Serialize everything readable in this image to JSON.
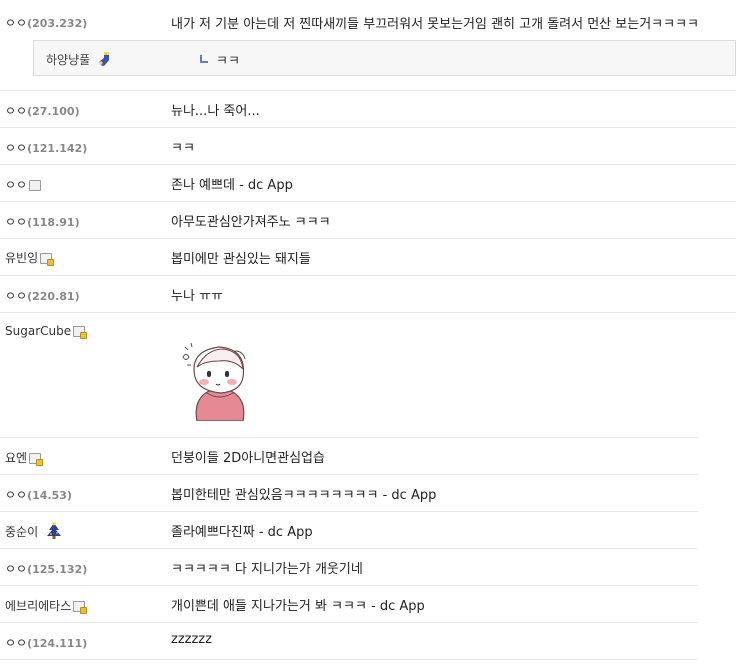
{
  "comments": [
    {
      "nick": "ㅇㅇ",
      "ip": "(203.232)",
      "text": "내가 저 기분 아는데 저 찐따새끼들 부끄러워서 못보는거임 괜히 고개 돌려서 먼산 보는거ㅋㅋㅋㅋ"
    },
    {
      "nick": "ㅇㅇ",
      "ip": "(27.100)",
      "text": "뉴나...나 죽어..."
    },
    {
      "nick": "ㅇㅇ",
      "ip": "(121.142)",
      "text": "ㅋㅋ"
    },
    {
      "nick": "ㅇㅇ",
      "ip": "",
      "text": "존나 예쁘데 - dc App"
    },
    {
      "nick": "ㅇㅇ",
      "ip": "(118.91)",
      "text": "아무도관심안가져주노 ㅋㅋㅋ"
    },
    {
      "nick": "유빈잉",
      "ip": "",
      "text": "봅미에만 관심있는 돼지들"
    },
    {
      "nick": "ㅇㅇ",
      "ip": "(220.81)",
      "text": "누나 ㅠㅠ"
    },
    {
      "nick": "SugarCube",
      "ip": "",
      "text": ""
    },
    {
      "nick": "요엔",
      "ip": "",
      "text": "던붕이들 2D아니면관심업습"
    },
    {
      "nick": "ㅇㅇ",
      "ip": "(14.53)",
      "text": "봅미한테만 관심있음ㅋㅋㅋㅋㅋㅋㅋㅋ - dc App"
    },
    {
      "nick": "중순이",
      "ip": "",
      "text": "졸라예쁘다진짜 - dc App"
    },
    {
      "nick": "ㅇㅇ",
      "ip": "(125.132)",
      "text": "ㅋㅋㅋㅋㅋ 다 지니가는가 개웃기네"
    },
    {
      "nick": "에브리에타스",
      "ip": "",
      "text": "개이쁜데 애들 지나가는거 봐 ㅋㅋㅋ - dc App"
    },
    {
      "nick": "ㅇㅇ",
      "ip": "(124.111)",
      "text": "zzzzzz"
    }
  ],
  "reply": {
    "nick": "하양냥풀",
    "text": "ㅋㅋ"
  },
  "icons": {
    "gallery_member": "gallery-member-icon",
    "blue_sock": "sock-icon",
    "tree": "tree-icon",
    "sticker": "sticker-image"
  }
}
